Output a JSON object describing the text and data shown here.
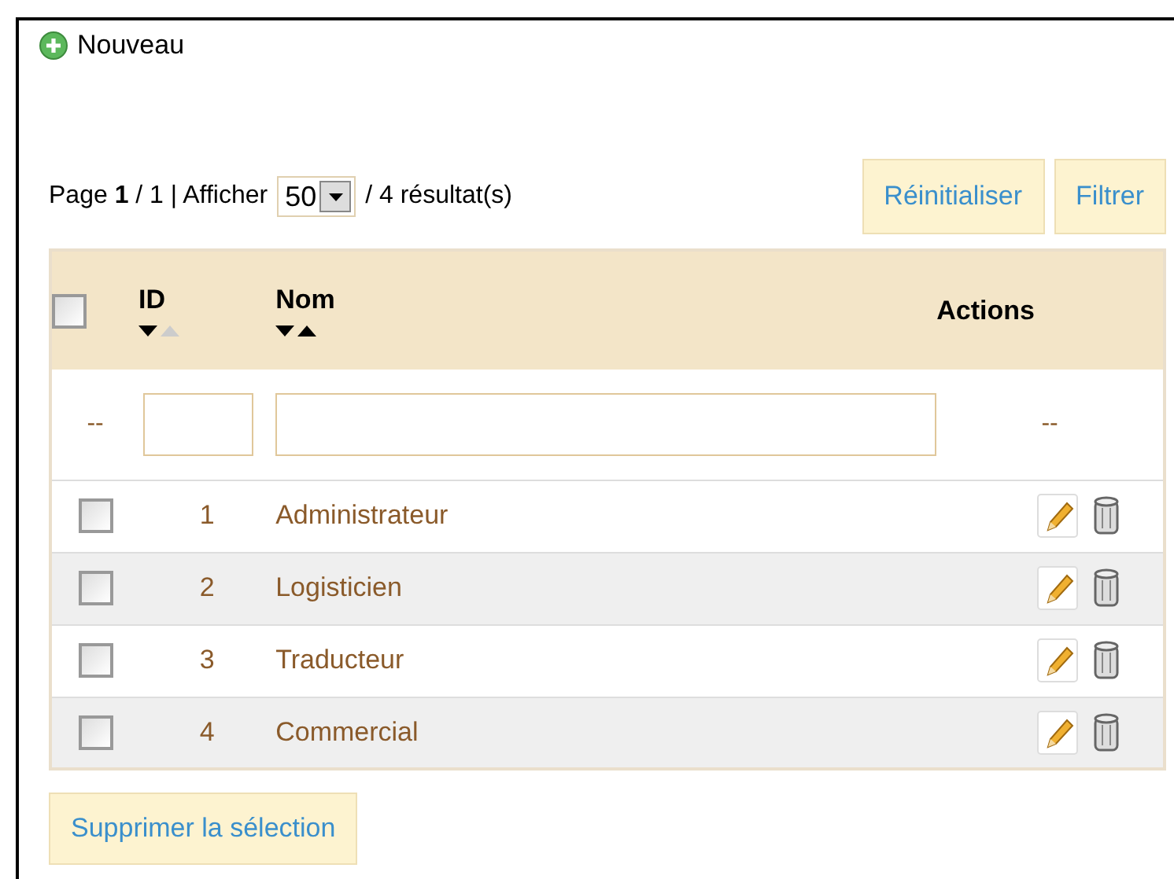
{
  "new_link": "Nouveau",
  "pagination": {
    "page_text": "Page **1** / 1 | Afficher",
    "per_page": "50",
    "results": "/ 4 résultat(s)"
  },
  "toolbar_buttons": [
    "Réinitialiser",
    "Filtrer"
  ],
  "table": {
    "select_all": {
      "checked": false
    },
    "columns": [
      {
        "label": "ID",
        "sorted_ascending": true
      },
      {
        "label": "Nom",
        "sorted_ascending": false
      },
      {
        "label": "Actions"
      }
    ],
    "filter_row": {
      "select_mark": "--",
      "actions_mark": "--"
    },
    "rows": [
      {
        "checked": false,
        "id": "1",
        "name": "Administrateur"
      },
      {
        "checked": false,
        "id": "2",
        "name": "Logisticien"
      },
      {
        "checked": false,
        "id": "3",
        "name": "Traducteur"
      },
      {
        "checked": false,
        "id": "4",
        "name": "Commercial"
      }
    ]
  },
  "bulk_button": "Supprimer la sélection"
}
